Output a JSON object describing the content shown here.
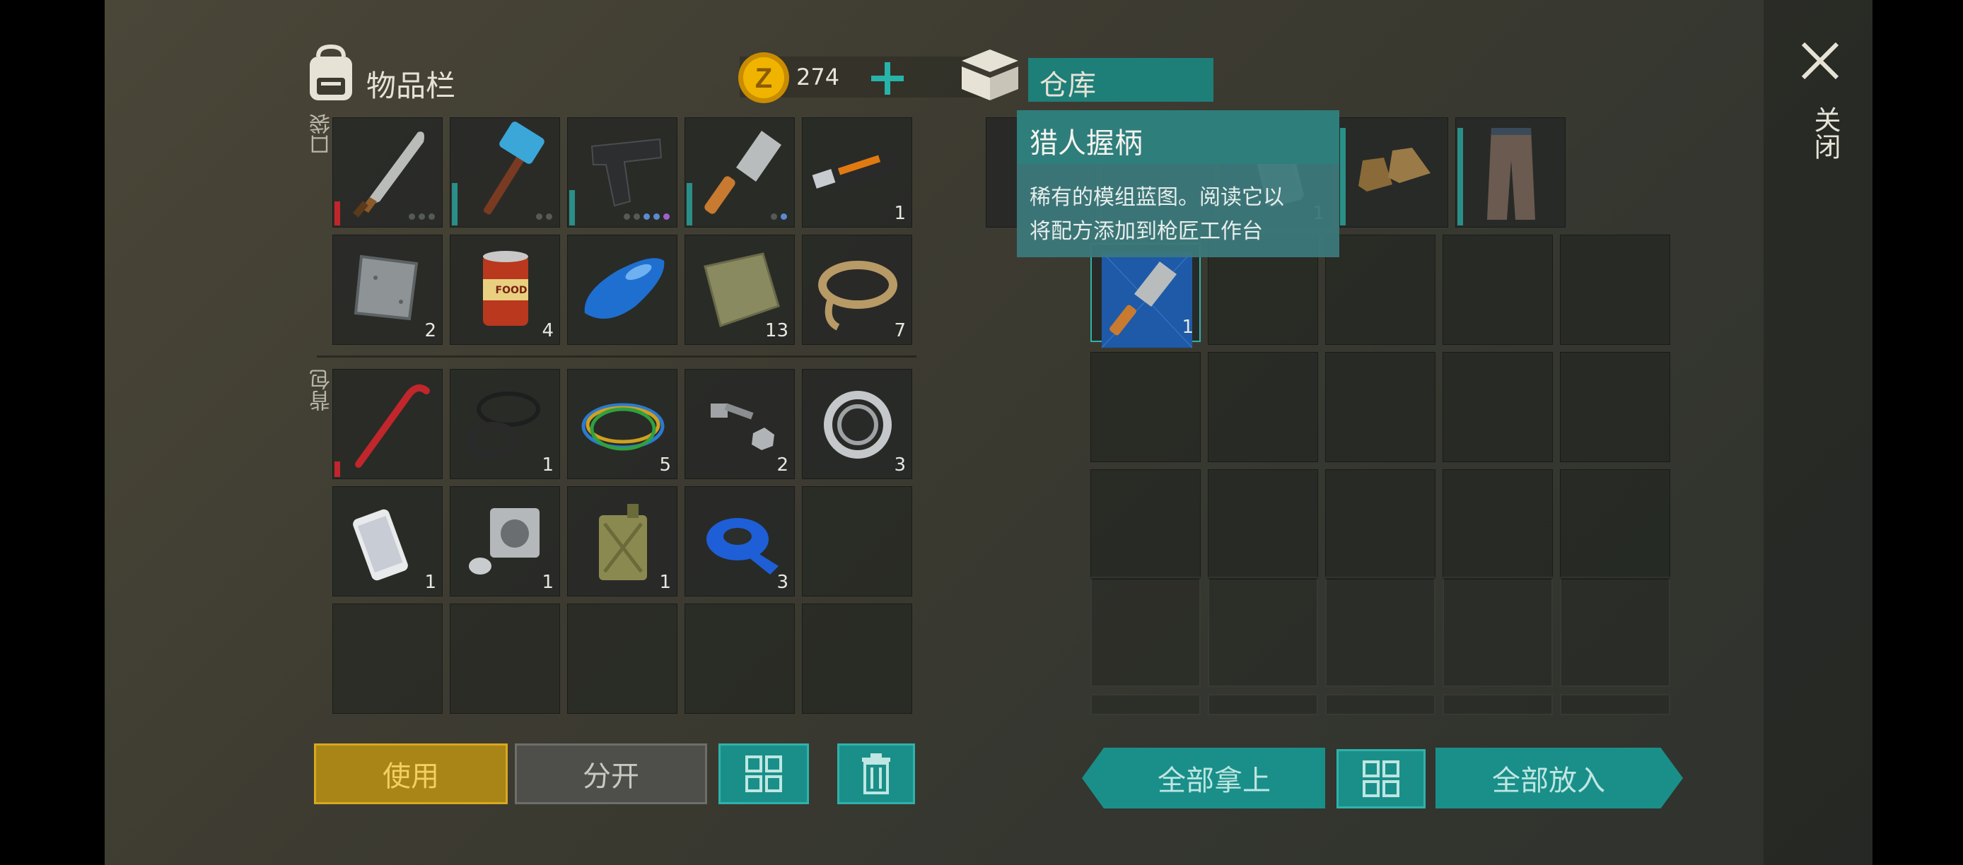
{
  "inventory": {
    "title": "物品栏",
    "coins": "274",
    "pocket_label": "口袋",
    "backpack_label": "背包"
  },
  "storage": {
    "title": "仓库"
  },
  "close_label": "关闭",
  "tooltip": {
    "title": "猎人握柄",
    "line1": "稀有的模组蓝图。阅读它以",
    "line2": "将配方添加到枪匠工作台"
  },
  "pocket_items": [
    {
      "name": "machete",
      "count": ""
    },
    {
      "name": "hammer",
      "count": ""
    },
    {
      "name": "pistol",
      "count": ""
    },
    {
      "name": "cleaver",
      "count": ""
    },
    {
      "name": "usb-drive",
      "count": "1"
    },
    {
      "name": "metal-plate",
      "count": "2"
    },
    {
      "name": "canned-food",
      "count": "4",
      "label": "FOOD"
    },
    {
      "name": "fuel-tank",
      "count": ""
    },
    {
      "name": "cloth",
      "count": "13"
    },
    {
      "name": "rope",
      "count": "7"
    }
  ],
  "backpack_items": [
    {
      "name": "crowbar",
      "count": ""
    },
    {
      "name": "rubber-seals",
      "count": "1"
    },
    {
      "name": "wires",
      "count": "5"
    },
    {
      "name": "bolts",
      "count": "2"
    },
    {
      "name": "bearing",
      "count": "3"
    },
    {
      "name": "smartphone",
      "count": "1"
    },
    {
      "name": "engine-cylinder",
      "count": "1"
    },
    {
      "name": "jerrycan",
      "count": "1"
    },
    {
      "name": "duct-tape",
      "count": "3"
    }
  ],
  "storage_items": [
    {
      "name": "smartphone",
      "count": "1"
    },
    {
      "name": "boots",
      "count": ""
    },
    {
      "name": "pants",
      "count": ""
    },
    {
      "name": "blueprint",
      "count": "1"
    }
  ],
  "buttons": {
    "use": "使用",
    "split": "分开",
    "take_all": "全部拿上",
    "put_all": "全部放入"
  },
  "colors": {
    "teal": "#1a8f89",
    "gold": "#e0a800",
    "durability_red": "#c0262b",
    "durability_teal": "#2a8f88"
  }
}
